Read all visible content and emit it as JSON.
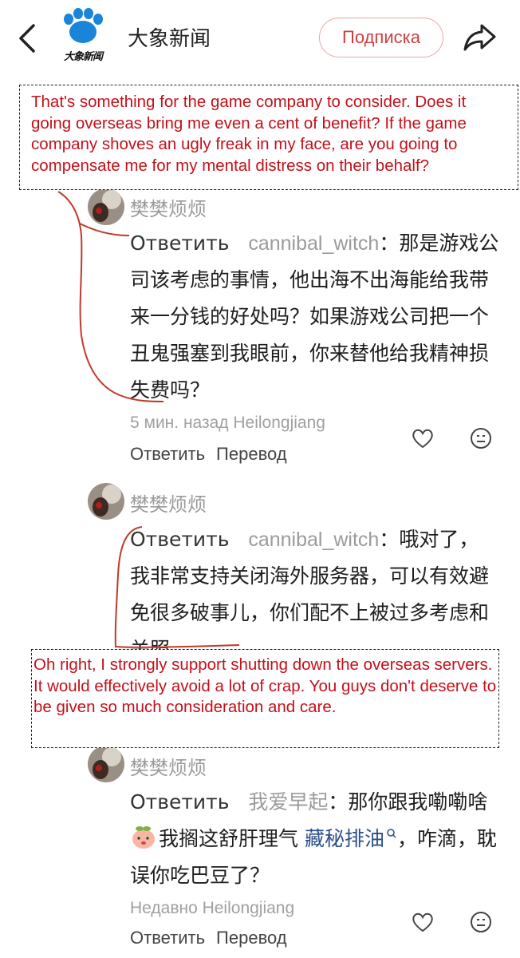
{
  "header": {
    "channel_name": "大象新闻",
    "logo_text": "大象新闻",
    "subscribe_label": "Подписка"
  },
  "translations": {
    "first": "That's something for the game company to consider. Does it going overseas bring me even a cent of benefit? If the game company shoves an ugly freak in my face, are you going to compensate me for my mental distress on their behalf?",
    "second": "Oh right, I strongly support shutting down the overseas servers. It would effectively avoid a lot of crap. You guys don't deserve to be given so much consideration and care."
  },
  "comments": [
    {
      "username": "樊樊烦烦",
      "reply_label": "Ответить",
      "reply_target": "cannibal_witch",
      "text": "：那是游戏公司该考虑的事情，他出海不出海能给我带来一分钱的好处吗？如果游戏公司把一个丑鬼强塞到我眼前，你来替他给我精神损失费吗？",
      "meta": "5 мин. назад Heilongjiang",
      "action_reply": "Ответить",
      "action_translate": "Перевод"
    },
    {
      "username": "樊樊烦烦",
      "reply_label": "Ответить",
      "reply_target": "cannibal_witch",
      "text": "：哦对了，我非常支持关闭海外服务器，可以有效避免很多破事儿，你们配不上被过多考虑和关照。"
    },
    {
      "username": "樊樊烦烦",
      "reply_label": "Ответить",
      "reply_target": "我爱早起",
      "text_before": "：那你跟我嘞嘞啥",
      "text_mid": "我搁这舒肝理气",
      "link_text": "藏秘排油",
      "text_after": "，咋滴，耽误你吃巴豆了？",
      "meta": "Недавно Heilongjiang",
      "action_reply": "Ответить",
      "action_translate": "Перевод"
    }
  ],
  "colors": {
    "translation_text": "#c4101a",
    "subscribe": "#d23d3d",
    "annotation": "#c0392b",
    "link": "#2c4e8a"
  },
  "icons": [
    "back-arrow-icon",
    "share-icon",
    "heart-icon",
    "smile-icon",
    "search-icon",
    "peach-emoji-icon"
  ]
}
